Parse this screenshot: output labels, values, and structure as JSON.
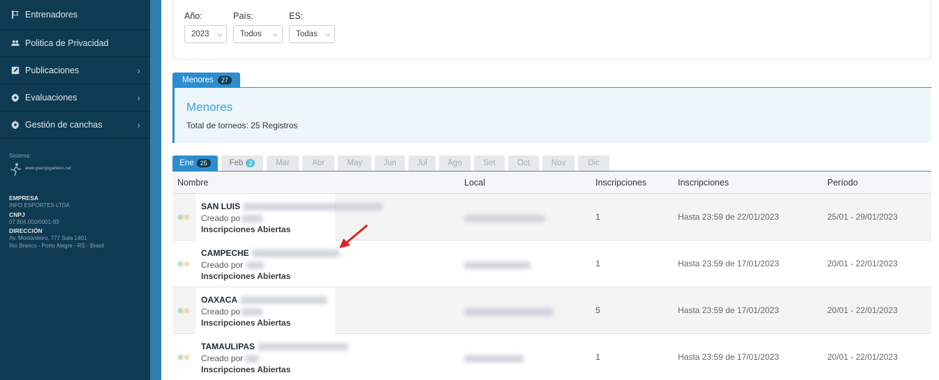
{
  "sidebar": {
    "items": [
      {
        "label": "Entrenadores",
        "icon": "flag-icon",
        "chevron": false
      },
      {
        "label": "Politica de Privacidad",
        "icon": "users-icon",
        "chevron": false
      },
      {
        "label": "Publicaciones",
        "icon": "edit-icon",
        "chevron": true
      },
      {
        "label": "Evaluaciones",
        "icon": "gear-icon",
        "chevron": true
      },
      {
        "label": "Gestión de canchas",
        "icon": "gear-icon",
        "chevron": true
      }
    ],
    "sistema_label": "Sistema:",
    "logo_text": "www.querojogartenis.net",
    "empresa_label": "EMPRESA",
    "empresa_value": "INFO ESPORTES LTDA",
    "cnpj_label": "CNPJ",
    "cnpj_value": "07.804.000/0001-93",
    "direccion_label": "DIRECCIÓN",
    "direccion_line1": "Av. Mostardeiro, 777 Sala 1401",
    "direccion_line2": "Rio Branco - Porto Alegre - RS - Brasil"
  },
  "filters": {
    "year_label": "Año:",
    "year_value": "2023",
    "country_label": "País:",
    "country_value": "Todos",
    "es_label": "ES:",
    "es_value": "Todas"
  },
  "category_tab": {
    "label": "Menores",
    "count": "27"
  },
  "panel": {
    "title": "Menores",
    "total_text": "Total de torneos: 25 Registros"
  },
  "months": [
    {
      "label": "Ene",
      "badge": "25",
      "active": true
    },
    {
      "label": "Feb",
      "badge": "2",
      "active": false
    },
    {
      "label": "Mar",
      "badge": "",
      "active": false
    },
    {
      "label": "Abr",
      "badge": "",
      "active": false
    },
    {
      "label": "May",
      "badge": "",
      "active": false
    },
    {
      "label": "Jun",
      "badge": "",
      "active": false
    },
    {
      "label": "Jul",
      "badge": "",
      "active": false
    },
    {
      "label": "Ago",
      "badge": "",
      "active": false
    },
    {
      "label": "Set",
      "badge": "",
      "active": false
    },
    {
      "label": "Oct",
      "badge": "",
      "active": false
    },
    {
      "label": "Nov",
      "badge": "",
      "active": false
    },
    {
      "label": "Dic",
      "badge": "",
      "active": false
    }
  ],
  "table": {
    "headers": [
      "Nombre",
      "Local",
      "Inscripciones",
      "Inscripciones",
      "Período"
    ],
    "rows": [
      {
        "name": "SAN LUIS",
        "creado": "Creado po",
        "status": "Inscripciones Abiertas",
        "inscripciones": "1",
        "hasta": "Hasta 23:59 de 22/01/2023",
        "periodo": "25/01 - 29/01/2023"
      },
      {
        "name": "CAMPECHE",
        "creado": "Creado por",
        "status": "Inscripciones Abiertas",
        "inscripciones": "1",
        "hasta": "Hasta 23:59 de 17/01/2023",
        "periodo": "20/01 - 22/01/2023"
      },
      {
        "name": "OAXACA",
        "creado": "Creado po",
        "status": "Inscripciones Abiertas",
        "inscripciones": "5",
        "hasta": "Hasta 23:59 de 17/01/2023",
        "periodo": "20/01 - 22/01/2023"
      },
      {
        "name": "TAMAULIPAS",
        "creado": "Creado por",
        "status": "Inscripciones Abiertas",
        "inscripciones": "1",
        "hasta": "Hasta 23:59 de 17/01/2023",
        "periodo": "20/01 - 22/01/2023"
      }
    ]
  },
  "colors": {
    "sidebar": "#0e3a52",
    "accent": "#2d8ecf",
    "arrow": "#e02020"
  }
}
